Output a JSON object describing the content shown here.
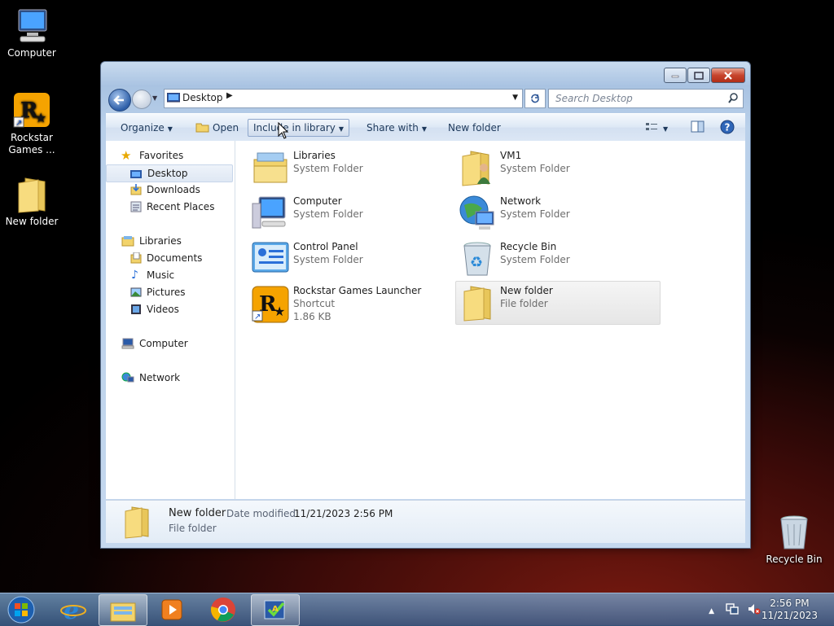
{
  "desktop": {
    "icons": [
      {
        "label": "Computer",
        "icon": "computer-icon"
      },
      {
        "label": "Rockstar Games ...",
        "icon": "rockstar-icon"
      },
      {
        "label": "New folder",
        "icon": "folder-icon"
      },
      {
        "label": "Recycle Bin",
        "icon": "recycle-bin-icon"
      }
    ]
  },
  "window": {
    "address": "Desktop",
    "search_placeholder": "Search Desktop",
    "toolbar": {
      "organize": "Organize",
      "open": "Open",
      "include": "Include in library",
      "share": "Share with",
      "new_folder": "New folder"
    },
    "nav": {
      "favorites": "Favorites",
      "desktop": "Desktop",
      "downloads": "Downloads",
      "recent": "Recent Places",
      "libraries": "Libraries",
      "documents": "Documents",
      "music": "Music",
      "pictures": "Pictures",
      "videos": "Videos",
      "computer": "Computer",
      "network": "Network"
    },
    "items": [
      {
        "name": "Libraries",
        "type": "System Folder"
      },
      {
        "name": "VM1",
        "type": "System Folder"
      },
      {
        "name": "Computer",
        "type": "System Folder"
      },
      {
        "name": "Network",
        "type": "System Folder"
      },
      {
        "name": "Control Panel",
        "type": "System Folder"
      },
      {
        "name": "Recycle Bin",
        "type": "System Folder"
      },
      {
        "name": "Rockstar Games Launcher",
        "type": "Shortcut",
        "size": "1.86 KB"
      },
      {
        "name": "New folder",
        "type": "File folder"
      }
    ],
    "details": {
      "name": "New folder",
      "modified_label": "Date modified:",
      "modified_value": "11/21/2023 2:56 PM",
      "type": "File folder"
    }
  },
  "taskbar": {
    "time": "2:56 PM",
    "date": "11/21/2023"
  },
  "colors": {
    "accent": "#1e395b",
    "folder": "#f2d36b",
    "rockstar": "#f5a300"
  }
}
